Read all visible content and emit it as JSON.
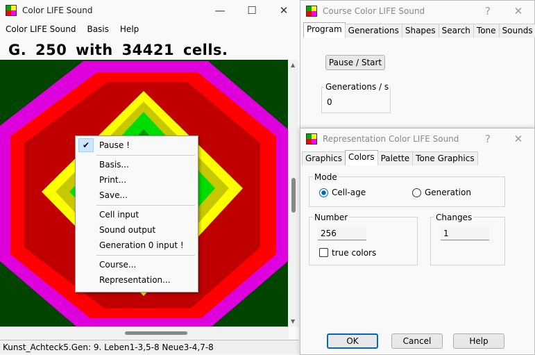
{
  "main": {
    "title": "Color LIFE Sound",
    "menu": [
      "Color LIFE Sound",
      "Basis",
      "Help"
    ],
    "generation_line": "G.  250  with  34421  cells.",
    "status": "Kunst_Achteck5.Gen: 9. Leben1-3,5-8 Neue3-4,7-8",
    "window_controls": {
      "minimize": "—",
      "maximize": "☐",
      "close": "✕"
    }
  },
  "context_menu": {
    "items": [
      {
        "label": "Pause !",
        "checked": true
      },
      {
        "label": "Basis..."
      },
      {
        "label": "Print..."
      },
      {
        "label": "Save..."
      },
      {
        "label": "Cell input"
      },
      {
        "label": "Sound output"
      },
      {
        "label": "Generation 0 input !"
      },
      {
        "label": "Course..."
      },
      {
        "label": "Representation..."
      }
    ]
  },
  "course": {
    "title": "Course Color LIFE Sound",
    "help": "?",
    "close": "✕",
    "tabs": [
      "Program",
      "Generations",
      "Shapes",
      "Search",
      "Tone",
      "Sounds"
    ],
    "active_tab": "Program",
    "pause_start": "Pause / Start",
    "gens_label": "Generations / s",
    "gens_value": "0"
  },
  "representation": {
    "title": "Representation Color LIFE Sound",
    "help": "?",
    "close": "✕",
    "tabs": [
      "Graphics",
      "Colors",
      "Palette",
      "Tone Graphics"
    ],
    "active_tab": "Colors",
    "mode_label": "Mode",
    "mode_cellage": "Cell-age",
    "mode_generation": "Generation",
    "mode_selected": "Cell-age",
    "number_label": "Number",
    "number_value": "256",
    "true_colors": "true colors",
    "true_colors_checked": false,
    "changes_label": "Changes",
    "changes_value": "1",
    "ok": "OK",
    "cancel": "Cancel",
    "help_btn": "Help"
  },
  "colors": {
    "accent": "#0067c0",
    "canvas_bg": "#004400",
    "magenta": "#e000e0",
    "red": "#ff0000",
    "yellow": "#ffff00",
    "green": "#00cc00"
  }
}
